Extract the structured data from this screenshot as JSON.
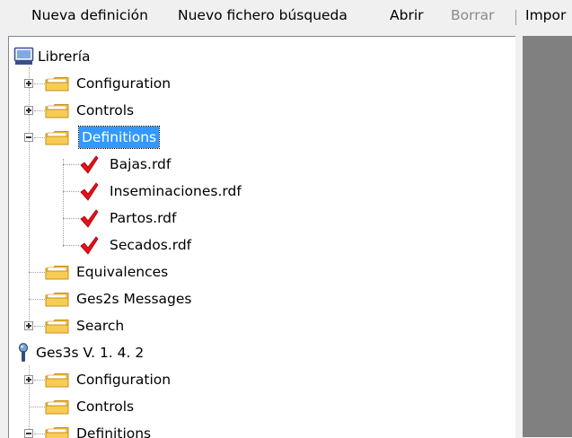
{
  "toolbar": {
    "nueva_definicion": "Nueva definición",
    "nuevo_fichero": "Nuevo fichero búsqueda",
    "abrir": "Abrir",
    "borrar": "Borrar",
    "importar": "Impor"
  },
  "tree": {
    "libreria": {
      "label": "Librería",
      "children": {
        "configuration": "Configuration",
        "controls": "Controls",
        "definitions": {
          "label": "Definitions",
          "files": [
            "Bajas.rdf",
            "Inseminaciones.rdf",
            "Partos.rdf",
            "Secados.rdf"
          ]
        },
        "equivalences": "Equivalences",
        "messages": "Ges2s Messages",
        "search": "Search"
      }
    },
    "ges3s": {
      "label": "Ges3s V. 1. 4. 2",
      "children": {
        "configuration": "Configuration",
        "controls": "Controls",
        "definitions": "Definitions"
      }
    }
  },
  "colors": {
    "selection": "#3399ff",
    "folder": "#f5c33f",
    "check": "#e8101a",
    "right_panel": "#808080"
  },
  "icons": {
    "root": "monitor-icon",
    "folder": "folder-icon",
    "file": "checkmark-icon",
    "root2": "pin-icon"
  }
}
